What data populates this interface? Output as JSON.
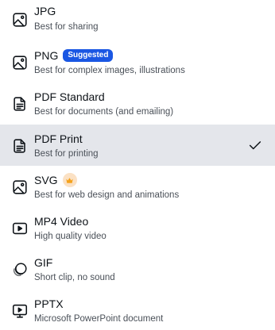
{
  "menu": {
    "items": [
      {
        "title": "JPG",
        "subtitle": "Best for sharing",
        "icon": "image-icon"
      },
      {
        "title": "PNG",
        "subtitle": "Best for complex images, illustrations",
        "icon": "image-icon",
        "badge": "Suggested"
      },
      {
        "title": "PDF Standard",
        "subtitle": "Best for documents (and emailing)",
        "icon": "document-icon"
      },
      {
        "title": "PDF Print",
        "subtitle": "Best for printing",
        "icon": "document-icon",
        "selected": true
      },
      {
        "title": "SVG",
        "subtitle": "Best for web design and animations",
        "icon": "image-icon",
        "premium_icon": "crown-icon"
      },
      {
        "title": "MP4 Video",
        "subtitle": "High quality video",
        "icon": "video-play-icon"
      },
      {
        "title": "GIF",
        "subtitle": "Short clip, no sound",
        "icon": "gif-icon"
      },
      {
        "title": "PPTX",
        "subtitle": "Microsoft PowerPoint document",
        "icon": "presentation-icon"
      }
    ]
  },
  "colors": {
    "selected_background": "#e4e6eb",
    "badge_background": "#1a57e3",
    "crown_background": "#fbe1c4",
    "crown": "#f4a21c",
    "text_primary": "#0e1318",
    "text_secondary": "#4a5058"
  }
}
